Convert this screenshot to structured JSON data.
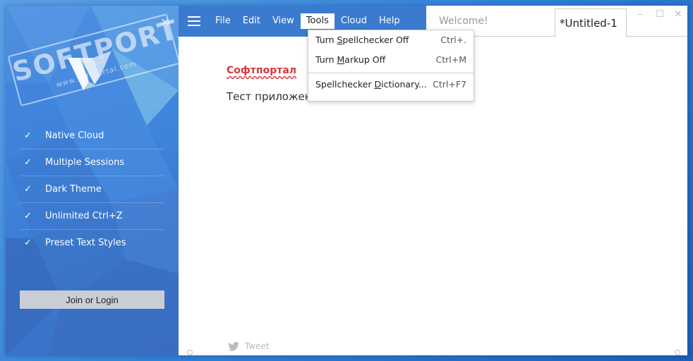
{
  "sidebar": {
    "watermark": "SOFTPORTAL",
    "watermark_sub": "www.softportal.com",
    "features": [
      {
        "label": "Native Cloud"
      },
      {
        "label": "Multiple Sessions"
      },
      {
        "label": "Dark Theme"
      },
      {
        "label": "Unlimited Ctrl+Z"
      },
      {
        "label": "Preset Text Styles"
      }
    ],
    "join_label": "Join or Login"
  },
  "menubar": {
    "items": [
      {
        "label": "File"
      },
      {
        "label": "Edit"
      },
      {
        "label": "View"
      },
      {
        "label": "Tools"
      },
      {
        "label": "Cloud"
      },
      {
        "label": "Help"
      }
    ],
    "active": "Tools"
  },
  "tabs": {
    "welcome": "Welcome!",
    "untitled": "*Untitled-1"
  },
  "tools_menu": {
    "items": [
      {
        "pre": "Turn ",
        "u": "S",
        "post": "pellchecker Off",
        "shortcut": "Ctrl+."
      },
      {
        "pre": "Turn ",
        "u": "M",
        "post": "arkup Off",
        "shortcut": "Ctrl+M"
      },
      {
        "pre": "Spellchecker ",
        "u": "D",
        "post": "ictionary...",
        "shortcut": "Ctrl+F7"
      }
    ]
  },
  "editor": {
    "title": "Софтпортал",
    "body": "Тест приложен"
  },
  "footer": {
    "tweet": "Tweet"
  },
  "colors": {
    "accent": "#3a7bd0",
    "spell_error": "#d9363e"
  }
}
